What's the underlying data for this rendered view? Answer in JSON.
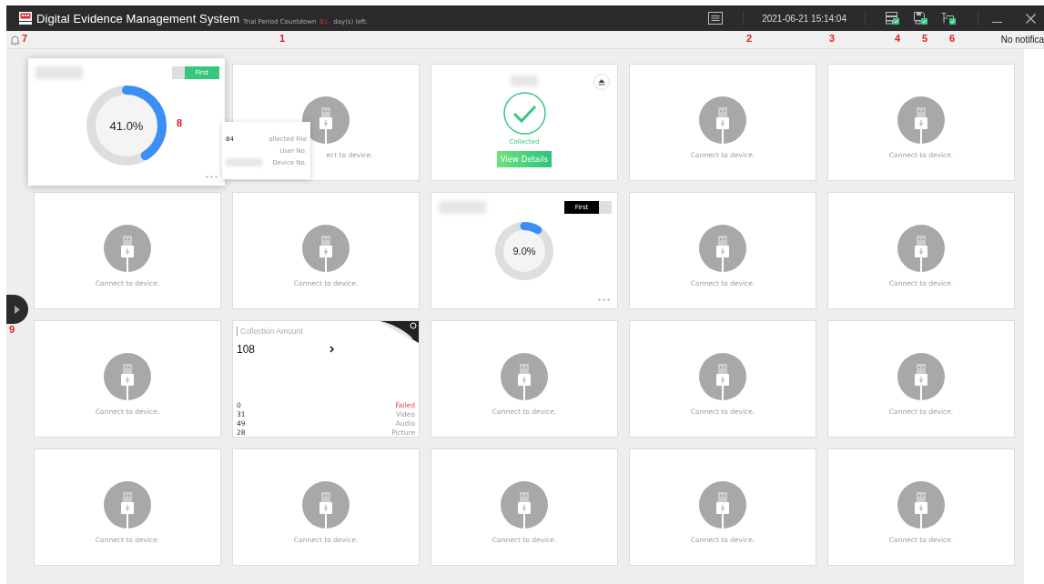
{
  "window": {
    "title": "Digital Evidence Management System",
    "trial_label": "Trial Period Countdown",
    "trial_days": "81",
    "trial_suffix": "day(s) left."
  },
  "toolbar": {
    "datetime": "2021-06-21 15:14:04"
  },
  "notification": "No notifica",
  "markers": [
    "7",
    "1",
    "2",
    "3",
    "4",
    "5",
    "6",
    "8",
    "9"
  ],
  "cards": [
    {
      "kind": "progress",
      "popup": true,
      "toggle": {
        "label": "First",
        "on": true
      },
      "level": 0.41,
      "reading": "41.0%",
      "tooltip": [
        {
          "value": "84",
          "label": "ollected File"
        },
        {
          "label": "User No."
        },
        {
          "label": "Device No.",
          "blurred": true
        }
      ]
    },
    {
      "kind": "covered",
      "text": "ect to device."
    },
    {
      "kind": "collected",
      "status": "Collected",
      "button": "View Details"
    },
    {
      "kind": "connect",
      "text": "Connect to device."
    },
    {
      "kind": "connect",
      "text": "Connect to device."
    },
    {
      "kind": "connect",
      "text": "Connect to device."
    },
    {
      "kind": "connect",
      "text": "Connect to device."
    },
    {
      "kind": "progress",
      "popup": false,
      "toggle": {
        "label": "First",
        "on": false
      },
      "level": 0.09,
      "reading": "9.0%"
    },
    {
      "kind": "connect",
      "text": "Connect to device."
    },
    {
      "kind": "connect",
      "text": "Connect to device."
    },
    {
      "kind": "connect",
      "text": "Connect to device."
    },
    {
      "kind": "amount",
      "title": "Collection Amount",
      "total": "108",
      "rows": [
        {
          "value": "0",
          "label": "Failed",
          "failed": true
        },
        {
          "value": "31",
          "label": "Video",
          "failed": false
        },
        {
          "value": "49",
          "label": "Audio",
          "failed": false
        },
        {
          "value": "28",
          "label": "Picture",
          "failed": false
        }
      ]
    },
    {
      "kind": "connect",
      "text": "Connect to device."
    },
    {
      "kind": "connect",
      "text": "Connect to device."
    },
    {
      "kind": "connect",
      "text": "Connect to device."
    },
    {
      "kind": "connect",
      "text": "Connect to device."
    },
    {
      "kind": "connect",
      "text": "Connect to device."
    },
    {
      "kind": "connect",
      "text": "Connect to device."
    },
    {
      "kind": "connect",
      "text": "Connect to device."
    },
    {
      "kind": "connect",
      "text": "Connect to device."
    }
  ]
}
